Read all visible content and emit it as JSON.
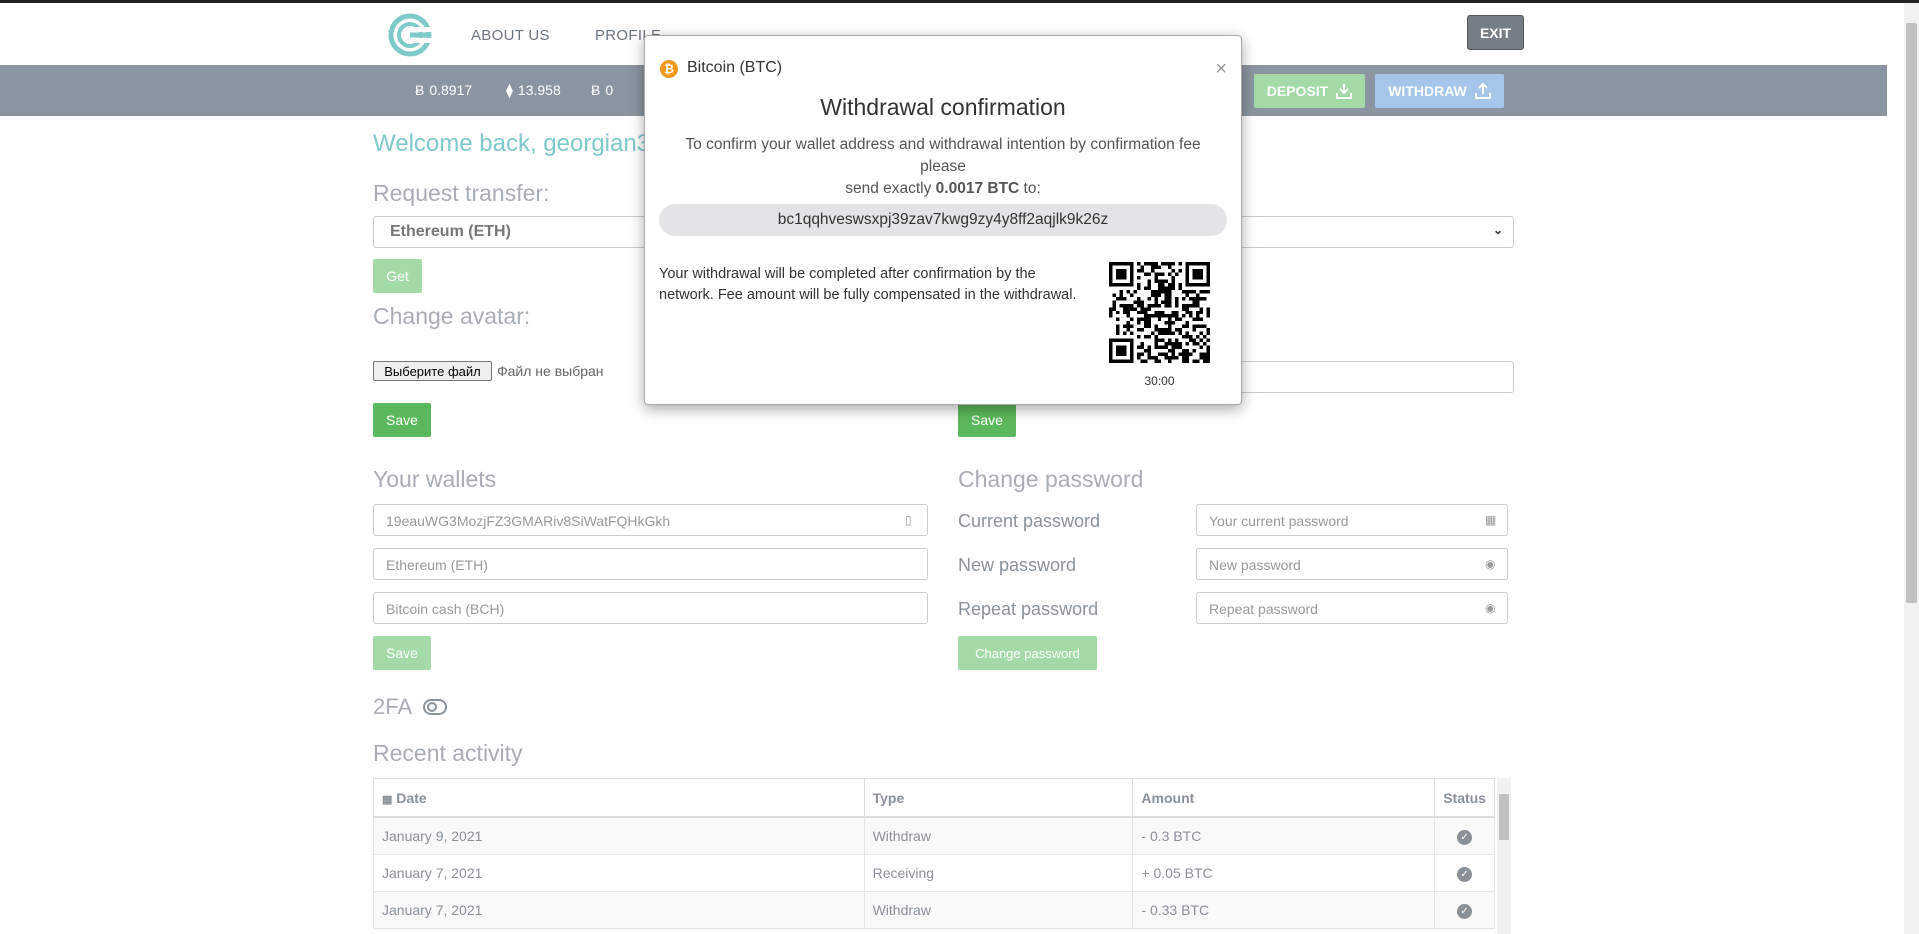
{
  "nav": {
    "about": "ABOUT US",
    "profile": "PROFILE",
    "exit": "EXIT"
  },
  "balances": [
    {
      "icon": "bitcoin-icon",
      "symbol": "Ƀ",
      "value": "0.8917"
    },
    {
      "icon": "ethereum-icon",
      "symbol": "⧫",
      "value": "13.958"
    },
    {
      "icon": "bitcoin-cash-icon",
      "symbol": "Ƀ",
      "value": "0"
    }
  ],
  "actions": {
    "deposit": "DEPOSIT",
    "withdraw": "WITHDRAW"
  },
  "welcome": "Welcome back, georgian3",
  "transfer": {
    "title": "Request transfer:",
    "selected": "Ethereum (ETH)",
    "get": "Get"
  },
  "avatar": {
    "title": "Change avatar:",
    "file_button": "Выберите файл",
    "file_status": "Файл не выбран",
    "save": "Save"
  },
  "right_form": {
    "save": "Save"
  },
  "wallets": {
    "title": "Your wallets",
    "btc_value": "19eauWG3MozjFZ3GMARiv8SiWatFQHkGkh",
    "eth_placeholder": "Ethereum (ETH)",
    "bch_placeholder": "Bitcoin cash (BCH)",
    "save": "Save"
  },
  "password": {
    "title": "Change password",
    "current_label": "Current password",
    "current_placeholder": "Your current password",
    "new_label": "New password",
    "new_placeholder": "New password",
    "repeat_label": "Repeat password",
    "repeat_placeholder": "Repeat password",
    "button": "Change password"
  },
  "twofa": {
    "label": "2FA"
  },
  "activity": {
    "title": "Recent activity",
    "headers": {
      "date": "Date",
      "type": "Type",
      "amount": "Amount",
      "status": "Status"
    },
    "rows": [
      {
        "date": "January 9, 2021",
        "type": "Withdraw",
        "amount": "- 0.3 BTC"
      },
      {
        "date": "January 7, 2021",
        "type": "Receiving",
        "amount": "+ 0.05 BTC"
      },
      {
        "date": "January 7, 2021",
        "type": "Withdraw",
        "amount": "- 0.33 BTC"
      }
    ]
  },
  "modal": {
    "coin": "Bitcoin (BTC)",
    "close": "×",
    "title": "Withdrawal confirmation",
    "desc_line1": "To confirm your wallet address and withdrawal intention by confirmation fee please",
    "desc_prefix": "send exactly ",
    "amount": "0.0017 BTC",
    "desc_suffix": " to:",
    "address": "bc1qqhveswsxpj39zav7kwg9zy4y8ff2aqjlk9k26z",
    "note": "Your withdrawal will be completed after confirmation by the network. Fee amount will be fully compensated in the withdrawal.",
    "timer": "30:00"
  },
  "colors": {
    "accent": "#7ec9c9",
    "bar": "#8b95a1",
    "green": "#5cb85c",
    "bitcoin": "#f39a1d"
  }
}
